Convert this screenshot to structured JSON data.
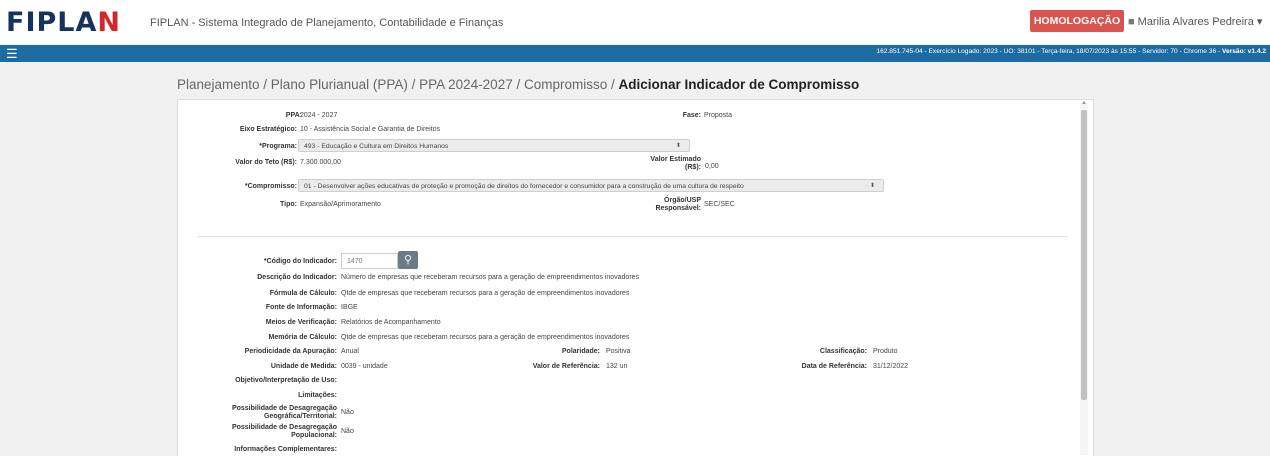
{
  "header": {
    "logo_text": "FIPLAN",
    "system_title": "FIPLAN - Sistema Integrado de Planejamento, Contabilidade e Finanças",
    "env_badge": "HOMOLOGAÇÃO",
    "user_name": "Marilia Alvares Pedreira",
    "user_caret": "▾",
    "status_line": "162.851.745-04 - Exercício Logado: 2023 - UO: 38101 - Terça-feira, 18/07/2023 às 15:55 - Servidor: 70 - Chrome 36 - ",
    "version_label": "Versão: v1.4.2"
  },
  "breadcrumb": {
    "path": "Planejamento / Plano Plurianual (PPA) / PPA 2024-2027 / Compromisso / ",
    "current": "Adicionar Indicador de Compromisso"
  },
  "form": {
    "ppa_label": "PPA:",
    "ppa_value": "2024 - 2027",
    "fase_label": "Fase:",
    "fase_value": "Proposta",
    "eixo_label": "Eixo Estratégico:",
    "eixo_value": "10 - Assistência Social e Garantia de Direitos",
    "programa_label": "*Programa:",
    "programa_value": "493 - Educação e Cultura em Direitos Humanos",
    "valor_teto_label": "Valor do Teto (R$):",
    "valor_teto_value": "7.300.000,00",
    "valor_estimado_label_1": "Valor Estimado",
    "valor_estimado_label_2": "(R$):",
    "valor_estimado_value": "0,00",
    "compromisso_label": "*Compromisso:",
    "compromisso_value": "01 - Desenvolver ações educativas de proteção e promoção de direitos do fornecedor e consumidor para a construção de uma cultura de respeito",
    "tipo_label": "Tipo:",
    "tipo_value": "Expansão/Aprimoramento",
    "orgao_label_1": "Órgão/USP",
    "orgao_label_2": "Responsável:",
    "orgao_value": "SEC/SEC"
  },
  "indicador": {
    "codigo_label": "*Código do Indicador:",
    "codigo_value": "1470",
    "descricao_label": "Descrição do Indicador:",
    "descricao_value": "Número de empresas que receberam recursos para a geração de empreendimentos inovadores",
    "formula_label": "Fórmula de Cálculo:",
    "formula_value": "Qtde de empresas que receberam recursos para a geração de empreendimentos inovadores",
    "fonte_label": "Fonte de Informação:",
    "fonte_value": "IBGE",
    "meios_label": "Meios de Verificação:",
    "meios_value": "Relatórios de Acompanhamento",
    "memoria_label": "Memória de Cálculo:",
    "memoria_value": "Qtde de empresas que receberam recursos para a geração de empreendimentos inovadores",
    "periodicidade_label": "Periodicidade da Apuração:",
    "periodicidade_value": "Anual",
    "polaridade_label": "Polaridade:",
    "polaridade_value": "Positiva",
    "classificacao_label": "Classificação:",
    "classificacao_value": "Produto",
    "unidade_label": "Unidade de Medida:",
    "unidade_value": "0039 - unidade",
    "valor_ref_label": "Valor de Referência:",
    "valor_ref_value": "132 un",
    "data_ref_label": "Data de Referência:",
    "data_ref_value": "31/12/2022",
    "objetivo_label": "Objetivo/Interpretação de Uso:",
    "limitacoes_label": "Limitações:",
    "desag_geo_label_1": "Possibilidade de Desagregação",
    "desag_geo_label_2": "Geográfica/Territorial:",
    "desag_geo_value": "Não",
    "desag_pop_label_1": "Possibilidade de Desagregação",
    "desag_pop_label_2": "Populacional:",
    "desag_pop_value": "Não",
    "info_comp_label": "Informações Complementares:"
  },
  "icons": {
    "menu": "☰",
    "user": "👤",
    "search": "🔍",
    "select_caret": "⬍",
    "scroll_up": "▲"
  },
  "colors": {
    "brand_blue": "#17325f",
    "brand_red": "#d4262b",
    "bar_blue": "#1c6ba3",
    "badge_red": "#d9534f"
  }
}
